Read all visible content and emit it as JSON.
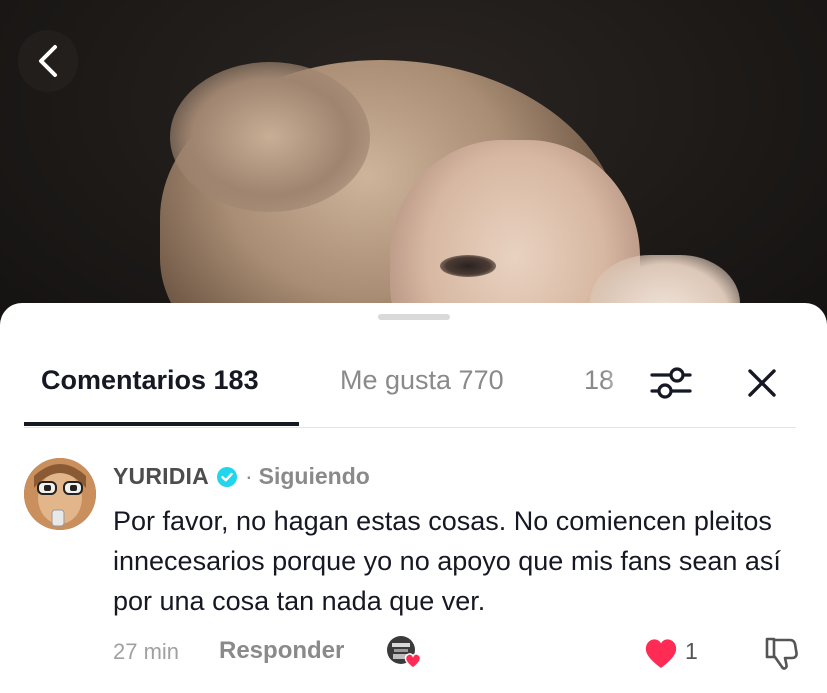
{
  "tabs": [
    {
      "label": "Comentarios 183"
    },
    {
      "label": "Me gusta 770"
    },
    {
      "label": "18"
    }
  ],
  "comment": {
    "username": "YURIDIA",
    "separator": "·",
    "follow_status": "Siguiendo",
    "text": "Por favor, no hagan estas cosas. No comiencen pleitos innecesarios porque yo no apoyo que mis fans sean así por una cosa tan nada que ver.",
    "time": "27 min",
    "reply_label": "Responder",
    "like_count": "1"
  },
  "colors": {
    "like_red": "#fe2c55",
    "verified_blue": "#20d5ec"
  },
  "icons": [
    "back-chevron-icon",
    "filter-sliders-icon",
    "close-icon",
    "verified-badge-icon",
    "heart-icon",
    "dislike-icon"
  ]
}
